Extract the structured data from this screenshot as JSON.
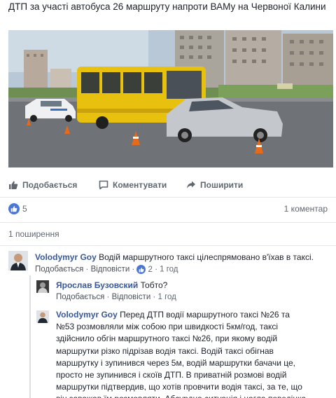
{
  "post": {
    "text": "ДТП за участі автобуса 26 маршруту напроти ВАМу на Червоної Калини"
  },
  "actions": {
    "like": "Подобається",
    "comment": "Коментувати",
    "share": "Поширити"
  },
  "reactions": {
    "likes": "5",
    "comments": "1 коментар",
    "shares": "1 поширення"
  },
  "comments": [
    {
      "author": "Volodymyr Goy",
      "text": "Водій маршрутного таксі цілеспрямовано в'їхав в таксі.",
      "like": "Подобається",
      "reply": "Відповісти",
      "reactions": "2",
      "time": "1 год"
    },
    {
      "author": "Ярослав Бузовский",
      "text": "Тобто?",
      "like": "Подобається",
      "reply": "Відповісти",
      "time": "1 год"
    },
    {
      "author": "Volodymyr Goy",
      "text": "Перед ДТП водії маршрутного таксі №26 та №53 розмовляли між собою при швидкості 5км/год, таксі здійснило обгін маршрутного таксі №26, при якому водій маршрутки різко підрізав водія таксі. Водій таксі обігнав маршрутку і зупинився через 5м, водій маршрутки бачачи це, просто не зупинився і скоїв ДТП. В приватній розмові водій маршрутки підтвердив, що хотів провчити водія таксі, за те, що він заважав їм розмовляти. Абсурдна ситуація і нагла поведінка водія маршрутки."
    }
  ],
  "colors": {
    "link": "#385898",
    "meta": "#606770",
    "like_blue": "#4a76d8",
    "bus_yellow": "#e8c10f"
  }
}
